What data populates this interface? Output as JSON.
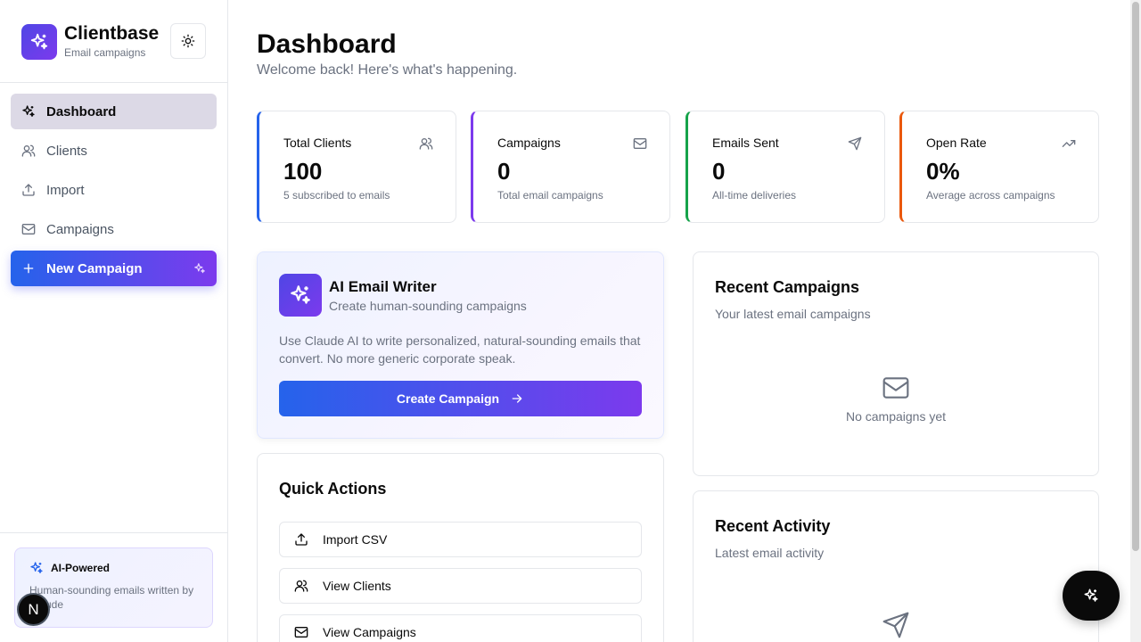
{
  "brand": {
    "name": "Clientbase",
    "subtitle": "Email campaigns",
    "logo_icon": "sparkles-icon"
  },
  "theme_toggle": {
    "icon": "sun-icon"
  },
  "sidebar": {
    "items": [
      {
        "label": "Dashboard",
        "icon": "sparkles-icon",
        "active": true
      },
      {
        "label": "Clients",
        "icon": "users-icon"
      },
      {
        "label": "Import",
        "icon": "upload-icon"
      },
      {
        "label": "Campaigns",
        "icon": "mail-icon"
      },
      {
        "label": "New Campaign",
        "icon": "plus-icon"
      }
    ],
    "ai_card": {
      "title": "AI-Powered",
      "text": "Human-sounding emails written by Claude"
    },
    "user_badge": "N"
  },
  "header": {
    "title": "Dashboard",
    "subtitle": "Welcome back! Here's what's happening."
  },
  "stats": [
    {
      "title": "Total Clients",
      "value": "100",
      "desc": "5 subscribed to emails",
      "icon": "users-icon",
      "accent": "#2563eb"
    },
    {
      "title": "Campaigns",
      "value": "0",
      "desc": "Total email campaigns",
      "icon": "mail-icon",
      "accent": "#7c3aed"
    },
    {
      "title": "Emails Sent",
      "value": "0",
      "desc": "All-time deliveries",
      "icon": "send-icon",
      "accent": "#16a34a"
    },
    {
      "title": "Open Rate",
      "value": "0%",
      "desc": "Average across campaigns",
      "icon": "trending-up-icon",
      "accent": "#ea580c"
    }
  ],
  "ai_writer": {
    "title": "AI Email Writer",
    "subtitle": "Create human-sounding campaigns",
    "body": "Use Claude AI to write personalized, natural-sounding emails that convert. No more generic corporate speak.",
    "button": "Create Campaign"
  },
  "quick_actions": {
    "title": "Quick Actions",
    "items": [
      {
        "label": "Import CSV",
        "icon": "upload-icon"
      },
      {
        "label": "View Clients",
        "icon": "users-icon"
      },
      {
        "label": "View Campaigns",
        "icon": "mail-icon"
      }
    ]
  },
  "recent_campaigns": {
    "title": "Recent Campaigns",
    "subtitle": "Your latest email campaigns",
    "empty": "No campaigns yet"
  },
  "recent_activity": {
    "title": "Recent Activity",
    "subtitle": "Latest email activity"
  },
  "fab": {
    "icon": "sparkles-icon"
  },
  "colors": {
    "accent_start": "#2563eb",
    "accent_end": "#7c3aed",
    "active_nav_bg": "#dcd9e6"
  }
}
